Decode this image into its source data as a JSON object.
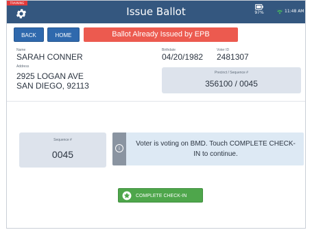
{
  "header": {
    "badge": "TRAINING",
    "title": "Issue Ballot",
    "battery": "97%",
    "time": "11:48 AM"
  },
  "toolbar": {
    "back_label": "BACK",
    "home_label": "HOME",
    "alert": "Ballot Already Issued by EPB"
  },
  "voter": {
    "name_label": "Name",
    "name": "SARAH CONNER",
    "birthdate_label": "Birthdate",
    "birthdate": "04/20/1982",
    "voter_id_label": "Voter ID",
    "voter_id": "2481307",
    "address_label": "Address",
    "address_line1": "2925 LOGAN AVE",
    "address_line2": "SAN DIEGO, 92113",
    "precinct_label": "Precinct / Sequence #",
    "precinct": "356100 / 0045"
  },
  "sequence": {
    "label": "Sequence #",
    "value": "0045"
  },
  "message": {
    "text": "Voter is voting on BMD. Touch COMPLETE CHECK-IN to continue."
  },
  "complete": {
    "label": "COMPLETE CHECK-IN"
  },
  "colors": {
    "header_bg": "#34577f",
    "primary_button": "#2f69ad",
    "alert": "#ec5a4f",
    "success": "#4ea64b",
    "training_badge": "#e23b3b",
    "panel_bg": "#dde3ec",
    "info_bg": "#dde9f4"
  },
  "icons": {
    "settings": "gear-icon",
    "battery": "battery-icon",
    "wifi": "wifi-icon",
    "info": "info-icon",
    "complete": "star-check-icon"
  }
}
